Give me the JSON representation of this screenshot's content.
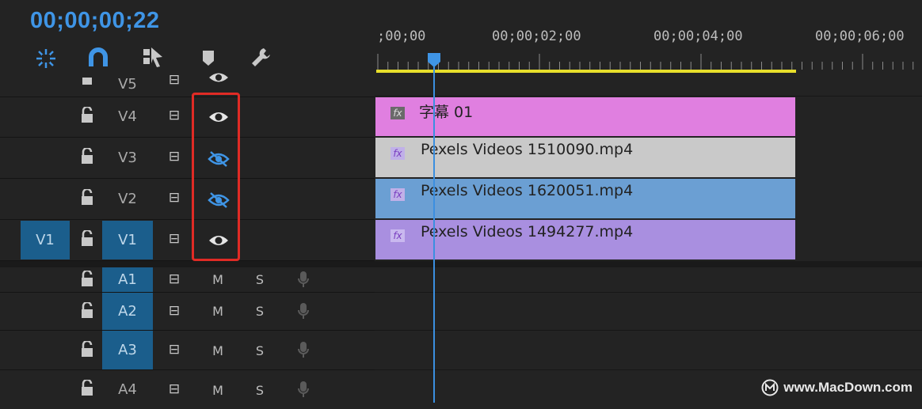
{
  "header": {
    "timecode": "00;00;00;22",
    "tools": [
      {
        "name": "snap-icon",
        "label": "⁜"
      },
      {
        "name": "magnet-icon",
        "label": "∩"
      },
      {
        "name": "linked-selection-icon",
        "label": "⧉"
      },
      {
        "name": "add-marker-icon",
        "label": "⬟"
      },
      {
        "name": "wrench-icon",
        "label": "🔧"
      }
    ]
  },
  "ruler": {
    "labels": [
      ";00;00",
      "00;00;02;00",
      "00;00;04;00",
      "00;00;06;00"
    ]
  },
  "tracks": {
    "video": [
      {
        "name": "V5",
        "lock": "🔓",
        "sync": "⊟",
        "eye": "visible"
      },
      {
        "name": "V4",
        "lock": "🔓",
        "sync": "⊟",
        "eye": "visible"
      },
      {
        "name": "V3",
        "lock": "🔓",
        "sync": "⊟",
        "eye": "hidden"
      },
      {
        "name": "V2",
        "lock": "🔓",
        "sync": "⊟",
        "eye": "hidden"
      },
      {
        "name": "V1",
        "lock": "🔓",
        "sync": "⊟",
        "eye": "visible",
        "source": "V1"
      }
    ],
    "audio": [
      {
        "name": "A1",
        "lock": "🔓",
        "sync": "⊟",
        "m": "M",
        "s": "S"
      },
      {
        "name": "A2",
        "lock": "🔓",
        "sync": "⊟",
        "m": "M",
        "s": "S"
      },
      {
        "name": "A3",
        "lock": "🔓",
        "sync": "⊟",
        "m": "M",
        "s": "S"
      },
      {
        "name": "A4",
        "lock": "🔓",
        "sync": "⊟",
        "m": "M",
        "s": "S"
      }
    ]
  },
  "clips": [
    {
      "label": "字幕 01",
      "fx": "fx",
      "color": "#e07fe0"
    },
    {
      "label": "Pexels Videos 1510090.mp4",
      "fx": "fx",
      "color": "#c9c9c9"
    },
    {
      "label": "Pexels Videos 1620051.mp4",
      "fx": "fx",
      "color": "#6b9fd3"
    },
    {
      "label": "Pexels Videos 1494277.mp4",
      "fx": "fx",
      "color": "#a98fe0"
    }
  ],
  "watermark": "www.MacDown.com",
  "colors": {
    "accent": "#3f95e6",
    "highlight": "#e02b25",
    "workarea": "#e7de2b"
  }
}
